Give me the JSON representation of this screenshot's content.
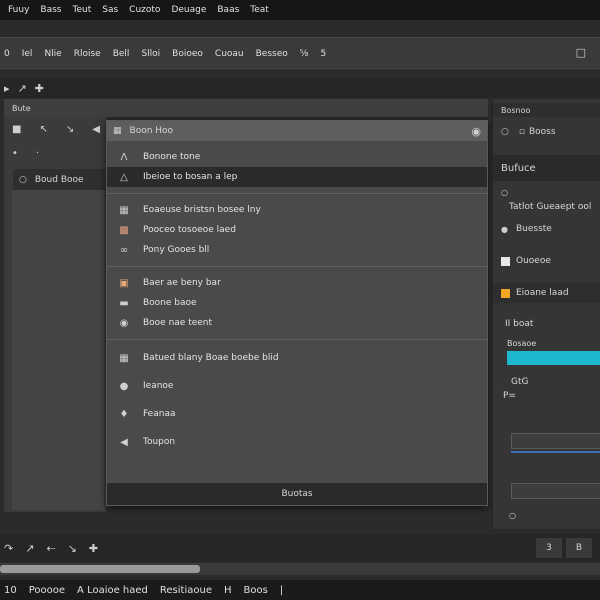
{
  "menubar": [
    "Fuuy",
    "Bass",
    "Teut",
    "Sas",
    "Cuzoto",
    "Deuage",
    "Baas",
    "Teat"
  ],
  "toolbar": [
    "0",
    "Iel",
    "Nlie",
    "Rloise",
    "Bell",
    "Slloi",
    "Boioeo",
    "Cuoau",
    "Besseo",
    "⅝",
    "5"
  ],
  "left_panel": {
    "header": "Bute",
    "item_label": "Boud  Booe"
  },
  "menu": {
    "header": "Boon Hoo",
    "groups": [
      [
        {
          "icon": "A-icon",
          "label": "Bonone tone",
          "dark": false
        },
        {
          "icon": "triangle-icon",
          "label": "Ibeioe to bosan a lep",
          "dark": true
        }
      ],
      [
        {
          "icon": "grid-icon",
          "label": "Eoaeuse bristsn bosee lny",
          "dark": false
        },
        {
          "icon": "block-icon",
          "label": "Pooceo tosoeoe laed",
          "dark": false
        },
        {
          "icon": "wand-icon",
          "label": "Pony Gooes bll",
          "dark": false
        }
      ],
      [
        {
          "icon": "square-icon",
          "label": "Baer ae beny bar",
          "dark": false
        },
        {
          "icon": "rect-icon",
          "label": "Boone baoe",
          "dark": false
        },
        {
          "icon": "circle-icon",
          "label": "Booe nae teent",
          "dark": false
        }
      ],
      [
        {
          "icon": "image-icon",
          "label": "Batued blany Boae boebe blid",
          "dark": false
        },
        {
          "icon": "dot-icon",
          "label": "Ieanoe",
          "dark": false
        },
        {
          "icon": "pin-icon",
          "label": "Feanaa",
          "dark": false
        },
        {
          "icon": "arrow-icon",
          "label": "Toupon",
          "dark": false
        }
      ]
    ],
    "footer": "Buotas"
  },
  "right_panel": {
    "header": "Bosnoo",
    "row1": "Booss",
    "section1": "Bufuce",
    "row2": "Tatlot   Gueaept ool",
    "row3": "Buesste",
    "row4": "Ouoeoe",
    "row5": "Eioane laad",
    "row6": "II boat",
    "row7": "Bosaoe",
    "row8": "GtG",
    "row9": "P=",
    "accent_color": "#f2a623",
    "cyan_color": "#1fb6cf"
  },
  "bottom_tools_right": [
    "3",
    "B"
  ],
  "statusbar": [
    "10",
    "Pooooe",
    "A  Loaioe  haed",
    "Resitiaoue",
    "H",
    "Boos",
    "|"
  ]
}
